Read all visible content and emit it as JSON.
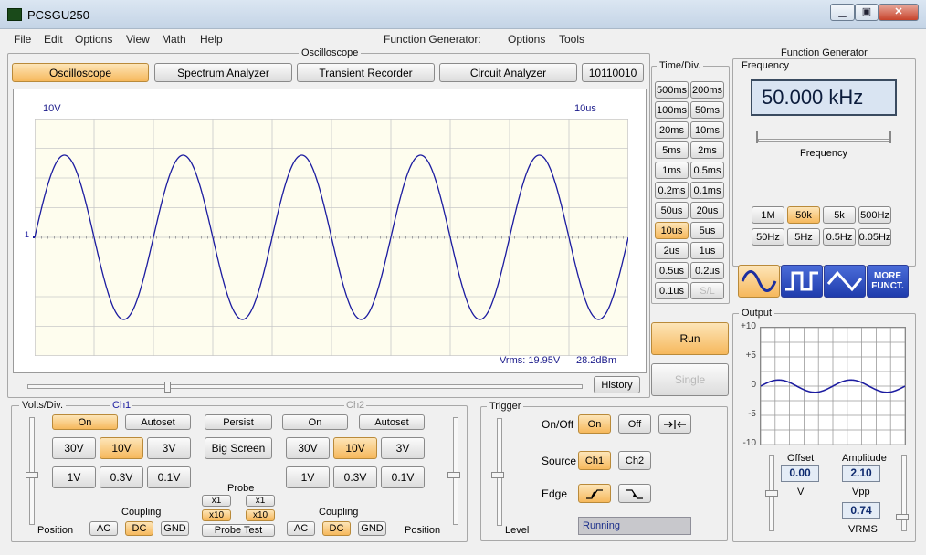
{
  "window": {
    "title": "PCSGU250",
    "minimize_label": "▁",
    "restore_label": "▣",
    "close_label": "✕"
  },
  "menu": {
    "items": [
      "File",
      "Edit",
      "Options",
      "View",
      "Math",
      "Help"
    ],
    "fg_items": [
      "Function Generator:",
      "Options",
      "Tools"
    ]
  },
  "oscilloscope": {
    "group_label": "Oscilloscope",
    "tabs": [
      "Oscilloscope",
      "Spectrum Analyzer",
      "Transient Recorder",
      "Circuit Analyzer",
      "10110010"
    ],
    "active_tab": 0,
    "volts_label": "10V",
    "time_label": "10us",
    "ch1_marker": "1",
    "vrms": "Vrms: 19.95V",
    "dbm": "28.2dBm",
    "history_label": "History"
  },
  "timediv": {
    "label": "Time/Div.",
    "buttons": [
      "500ms",
      "200ms",
      "100ms",
      "50ms",
      "20ms",
      "10ms",
      "5ms",
      "2ms",
      "1ms",
      "0.5ms",
      "0.2ms",
      "0.1ms",
      "50us",
      "20us",
      "10us",
      "5us",
      "2us",
      "1us",
      "0.5us",
      "0.2us",
      "0.1us",
      "S/L"
    ],
    "active": "10us",
    "disabled": "S/L",
    "run_label": "Run",
    "single_label": "Single"
  },
  "volts": {
    "label": "Volts/Div.",
    "ch1_label": "Ch1",
    "ch2_label": "Ch2",
    "on_label": "On",
    "autoset_label": "Autoset",
    "persist_label": "Persist",
    "big_screen_label": "Big Screen",
    "ch1_ranges": [
      "30V",
      "10V",
      "3V",
      "1V",
      "0.3V",
      "0.1V"
    ],
    "ch1_active": "10V",
    "ch2_ranges": [
      "30V",
      "10V",
      "3V",
      "1V",
      "0.3V",
      "0.1V"
    ],
    "ch2_active": "10V",
    "probe_label": "Probe",
    "probe_x1": "x1",
    "probe_x10": "x10",
    "probe_test_label": "Probe Test",
    "coupling_label": "Coupling",
    "coupling": [
      "AC",
      "DC",
      "GND"
    ],
    "coupling_active": "DC",
    "position_label": "Position"
  },
  "trigger": {
    "label": "Trigger",
    "onoff_label": "On/Off",
    "on_label": "On",
    "off_label": "Off",
    "source_label": "Source",
    "ch1_label": "Ch1",
    "ch2_label": "Ch2",
    "edge_label": "Edge",
    "level_label": "Level",
    "status": "Running"
  },
  "function_generator": {
    "group_label": "Function Generator",
    "frequency_label": "Frequency",
    "frequency_value": "50.000 kHz",
    "slider_label": "Frequency",
    "ranges": [
      "1M",
      "50k",
      "5k",
      "500Hz",
      "50Hz",
      "5Hz",
      "0.5Hz",
      "0.05Hz"
    ],
    "active_range": "50k",
    "more_label_1": "MORE",
    "more_label_2": "FUNCT.",
    "output_label": "Output",
    "y_ticks": [
      "+10",
      "+5",
      "0",
      "-5",
      "-10"
    ],
    "offset_label": "Offset",
    "offset_value": "0.00",
    "offset_unit": "V",
    "amplitude_label": "Amplitude",
    "amplitude_value": "2.10",
    "vpp_label": "Vpp",
    "vrms_value": "0.74",
    "vrms_label": "VRMS"
  },
  "colors": {
    "trace": "#1c1ca0",
    "grid": "#c8c8c8",
    "active_button": "#f6b85c",
    "lcd_bg": "#d9e4f2"
  }
}
